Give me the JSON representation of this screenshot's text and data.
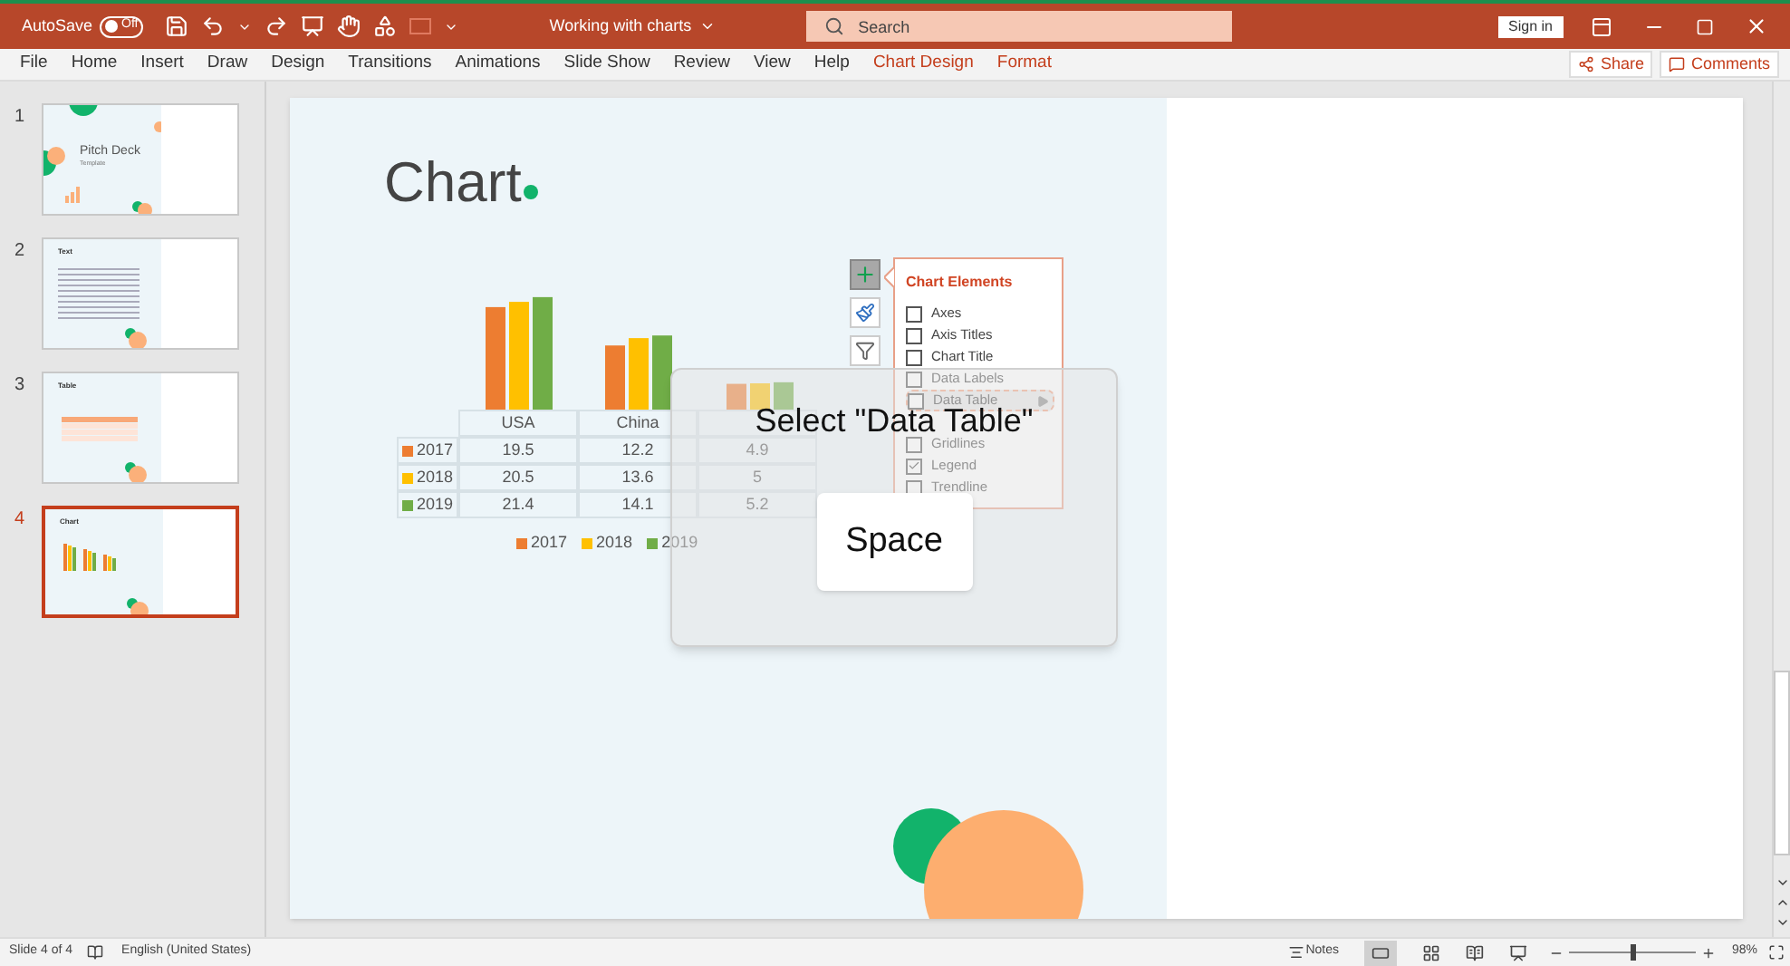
{
  "title_bar": {
    "autosave_label": "AutoSave",
    "autosave": {
      "on": false,
      "label": "Off"
    },
    "document_title": "Working with charts",
    "search": {
      "placeholder": "Search"
    },
    "sign_in": "Sign in"
  },
  "ribbon_tabs": [
    {
      "label": "File",
      "kind": "normal"
    },
    {
      "label": "Home",
      "kind": "normal"
    },
    {
      "label": "Insert",
      "kind": "normal"
    },
    {
      "label": "Draw",
      "kind": "normal"
    },
    {
      "label": "Design",
      "kind": "normal"
    },
    {
      "label": "Transitions",
      "kind": "normal"
    },
    {
      "label": "Animations",
      "kind": "normal"
    },
    {
      "label": "Slide Show",
      "kind": "normal"
    },
    {
      "label": "Review",
      "kind": "normal"
    },
    {
      "label": "View",
      "kind": "normal"
    },
    {
      "label": "Help",
      "kind": "normal"
    },
    {
      "label": "Chart Design",
      "kind": "contextual"
    },
    {
      "label": "Format",
      "kind": "contextual"
    }
  ],
  "share": "Share",
  "comments": "Comments",
  "slides": [
    {
      "number": "1",
      "kind": "title",
      "title": "Pitch Deck",
      "subtitle": "Template",
      "selected": false
    },
    {
      "number": "2",
      "kind": "text",
      "title": "Text",
      "selected": false
    },
    {
      "number": "3",
      "kind": "table",
      "title": "Table",
      "selected": false
    },
    {
      "number": "4",
      "kind": "chart",
      "title": "Chart",
      "selected": true
    }
  ],
  "slide": {
    "title": "Chart",
    "chart": {
      "legend": [
        {
          "label": "2017",
          "color": "#ed7d31"
        },
        {
          "label": "2018",
          "color": "#ffc000"
        },
        {
          "label": "2019",
          "color": "#70ad47"
        }
      ],
      "table": {
        "columns": [
          "USA",
          "China"
        ],
        "rows": [
          {
            "label": "2017",
            "color": "#ed7d31",
            "cells": [
              "19.5",
              "12.2",
              "4.9"
            ]
          },
          {
            "label": "2018",
            "color": "#ffc000",
            "cells": [
              "20.5",
              "13.6",
              "5"
            ]
          },
          {
            "label": "2019",
            "color": "#70ad47",
            "cells": [
              "21.4",
              "14.1",
              "5.2"
            ]
          }
        ]
      }
    },
    "chart_buttons": [
      {
        "kind": "add",
        "selected": true
      },
      {
        "kind": "style",
        "selected": false
      },
      {
        "kind": "filter",
        "selected": false
      }
    ],
    "chart_elements": {
      "title": "Chart Elements",
      "items": [
        {
          "kind": "option",
          "label": "Axes",
          "checked": false,
          "selected": false
        },
        {
          "kind": "option",
          "label": "Axis Titles",
          "checked": false,
          "selected": false
        },
        {
          "kind": "option",
          "label": "Chart Title",
          "checked": false,
          "selected": false
        },
        {
          "kind": "option",
          "label": "Data Labels",
          "checked": false,
          "selected": false
        },
        {
          "kind": "option",
          "label": "Data Table",
          "checked": false,
          "selected": true
        },
        {
          "kind": "covered"
        },
        {
          "kind": "option",
          "label": "Gridlines",
          "checked": false,
          "selected": false
        },
        {
          "kind": "option",
          "label": "Legend",
          "checked": true,
          "selected": false
        },
        {
          "kind": "option",
          "label": "Trendline",
          "checked": false,
          "selected": false
        }
      ]
    },
    "keystroke_overlay": {
      "action": "Select \"Data Table\"",
      "key": "Space"
    }
  },
  "status_bar": {
    "slide_info": "Slide 4 of 4",
    "language": "English (United States)",
    "notes": "Notes",
    "zoom": {
      "level": 0.5,
      "reading": "98%"
    }
  }
}
